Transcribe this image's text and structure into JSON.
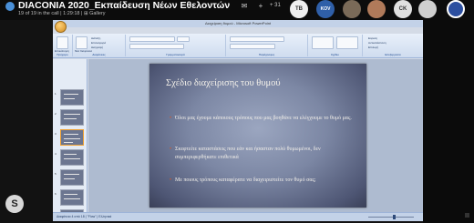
{
  "meeting": {
    "title": "DIACONIA 2020_Εκπαίδευση Νέων Εθελοντών",
    "subtitle": "19 of 19 in the call | 1:29:18 | ⊞ Gallery",
    "participant_extra": "+ 31",
    "avatars": [
      {
        "initials": "TB"
      },
      {
        "initials": "KOV"
      },
      {
        "initials": ""
      },
      {
        "initials": ""
      },
      {
        "initials": "CK"
      },
      {
        "initials": ""
      },
      {
        "initials": ""
      }
    ]
  },
  "powerpoint": {
    "window_title": "Διαχείριση θυμού - Microsoft PowerPoint",
    "tabs": [
      "Κεντρική",
      "Εισαγωγή",
      "Σχεδίαση",
      "Κίνηση",
      "Προβολή παρουσίασης",
      "Αναθεώρηση",
      "Προβολή"
    ],
    "ribbon_groups": [
      "Πρόχειρο",
      "Διαφάνειες",
      "Γραμματοσειρά",
      "Παράγραφος",
      "Σχέδιο",
      "Επεξεργασία"
    ],
    "ribbon_buttons": [
      "Επικόλληση",
      "Νέα διαφάνεια",
      "Διάταξη",
      "Επαναφορά",
      "Διαγραφή",
      "Εύρεση",
      "Αντικατάσταση",
      "Επιλογή"
    ],
    "thumbnail_numbers": [
      "1",
      "2",
      "3",
      "4",
      "5",
      "6",
      "7",
      "8"
    ],
    "selected_thumbnail": "4",
    "slide": {
      "title": "Σχέδιο διαχείρισης του θυμού",
      "bullets": [
        "Όλοι μας έχουμε κάποιους τρόπους που μας βοηθάνε να ελέγχουμε το θυμό μας.",
        "Σκεφτείτε καταστάσεις που εάν και ήσασταν πολύ θυμωμένοι, δεν συμπεριφερθήκατε επιθετικά",
        "Με ποιους τρόπους καταφέρατε να διαχειριστείτε τον θυμό σας;"
      ]
    },
    "status": "Διαφάνεια 4 από 18  |  \"Flow\"  |  Ελληνικά"
  },
  "colors": {
    "bullet": "#e0561e",
    "slide_bg": "#7c87a4",
    "ribbon": "#cfdcef"
  }
}
